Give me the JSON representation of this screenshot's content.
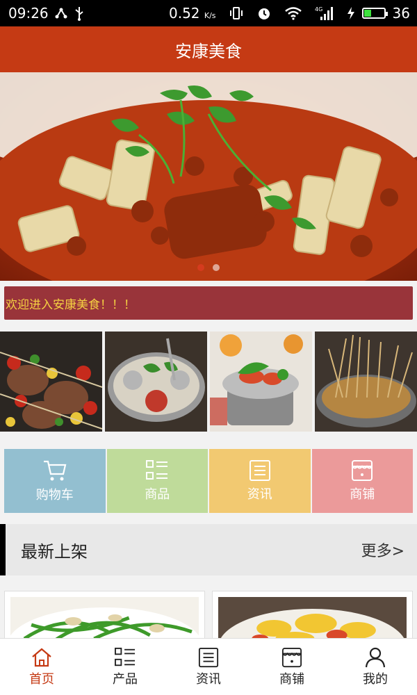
{
  "status_bar": {
    "time": "09:26",
    "network_speed": "0.52",
    "network_unit": "K/s",
    "battery_level": "36",
    "battery_fraction": 0.36,
    "signal_label": "4G"
  },
  "header": {
    "title": "安康美食"
  },
  "banner": {
    "slide_count": 2,
    "active_slide": 0
  },
  "marquee": {
    "text": "欢迎进入安康美食！！！"
  },
  "categories": [
    {
      "label": "购物车",
      "icon": "shopping-cart-icon",
      "color": "#93bfd0"
    },
    {
      "label": "商品",
      "icon": "grid-list-icon",
      "color": "#bfdb9a"
    },
    {
      "label": "资讯",
      "icon": "news-icon",
      "color": "#f2c971"
    },
    {
      "label": "商铺",
      "icon": "store-icon",
      "color": "#eb9a9a"
    }
  ],
  "section": {
    "title": "最新上架",
    "more": "更多>"
  },
  "bottom_nav": [
    {
      "label": "首页",
      "icon": "home-icon",
      "active": true
    },
    {
      "label": "产品",
      "icon": "grid-list-icon",
      "active": false
    },
    {
      "label": "资讯",
      "icon": "news-icon",
      "active": false
    },
    {
      "label": "商铺",
      "icon": "store-icon",
      "active": false
    },
    {
      "label": "我的",
      "icon": "user-icon",
      "active": false
    }
  ],
  "colors": {
    "brand": "#c53a14",
    "marquee_bg": "#99343a",
    "marquee_text": "#f5d142"
  }
}
